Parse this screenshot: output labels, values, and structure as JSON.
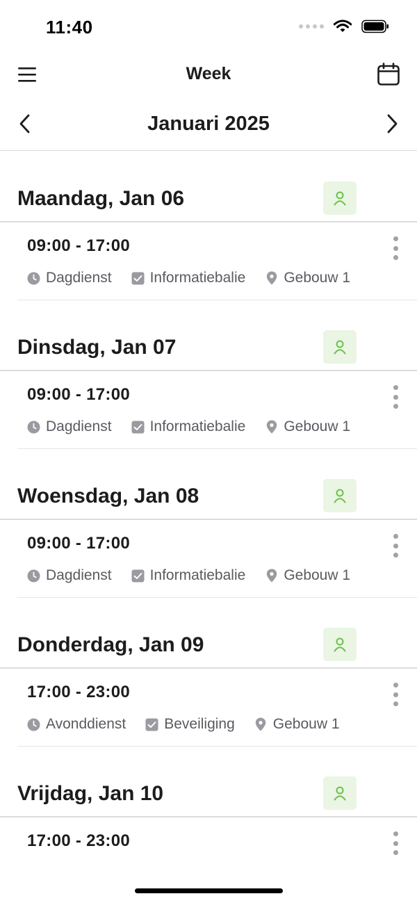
{
  "status_bar": {
    "time": "11:40"
  },
  "header": {
    "title": "Week"
  },
  "month_nav": {
    "title": "Januari 2025"
  },
  "days": [
    {
      "title": "Maandag, Jan 06",
      "shift": {
        "time": "09:00 - 17:00",
        "type": "Dagdienst",
        "task": "Informatiebalie",
        "location": "Gebouw 1"
      }
    },
    {
      "title": "Dinsdag, Jan 07",
      "shift": {
        "time": "09:00 - 17:00",
        "type": "Dagdienst",
        "task": "Informatiebalie",
        "location": "Gebouw 1"
      }
    },
    {
      "title": "Woensdag, Jan 08",
      "shift": {
        "time": "09:00 - 17:00",
        "type": "Dagdienst",
        "task": "Informatiebalie",
        "location": "Gebouw 1"
      }
    },
    {
      "title": "Donderdag, Jan 09",
      "shift": {
        "time": "17:00 - 23:00",
        "type": "Avonddienst",
        "task": "Beveiliging",
        "location": "Gebouw 1"
      }
    },
    {
      "title": "Vrijdag, Jan 10",
      "shift": {
        "time": "17:00 - 23:00",
        "type": "",
        "task": "",
        "location": ""
      }
    }
  ],
  "colors": {
    "accent_green": "#6cc04a",
    "badge_bg": "#eaf5e4",
    "meta_icon": "#9a9aa0",
    "divider": "#dcdce0"
  },
  "icons": [
    "menu-icon",
    "calendar-icon",
    "chevron-left-icon",
    "chevron-right-icon",
    "person-icon",
    "clock-icon",
    "checkbox-icon",
    "location-pin-icon",
    "more-vertical-icon"
  ]
}
